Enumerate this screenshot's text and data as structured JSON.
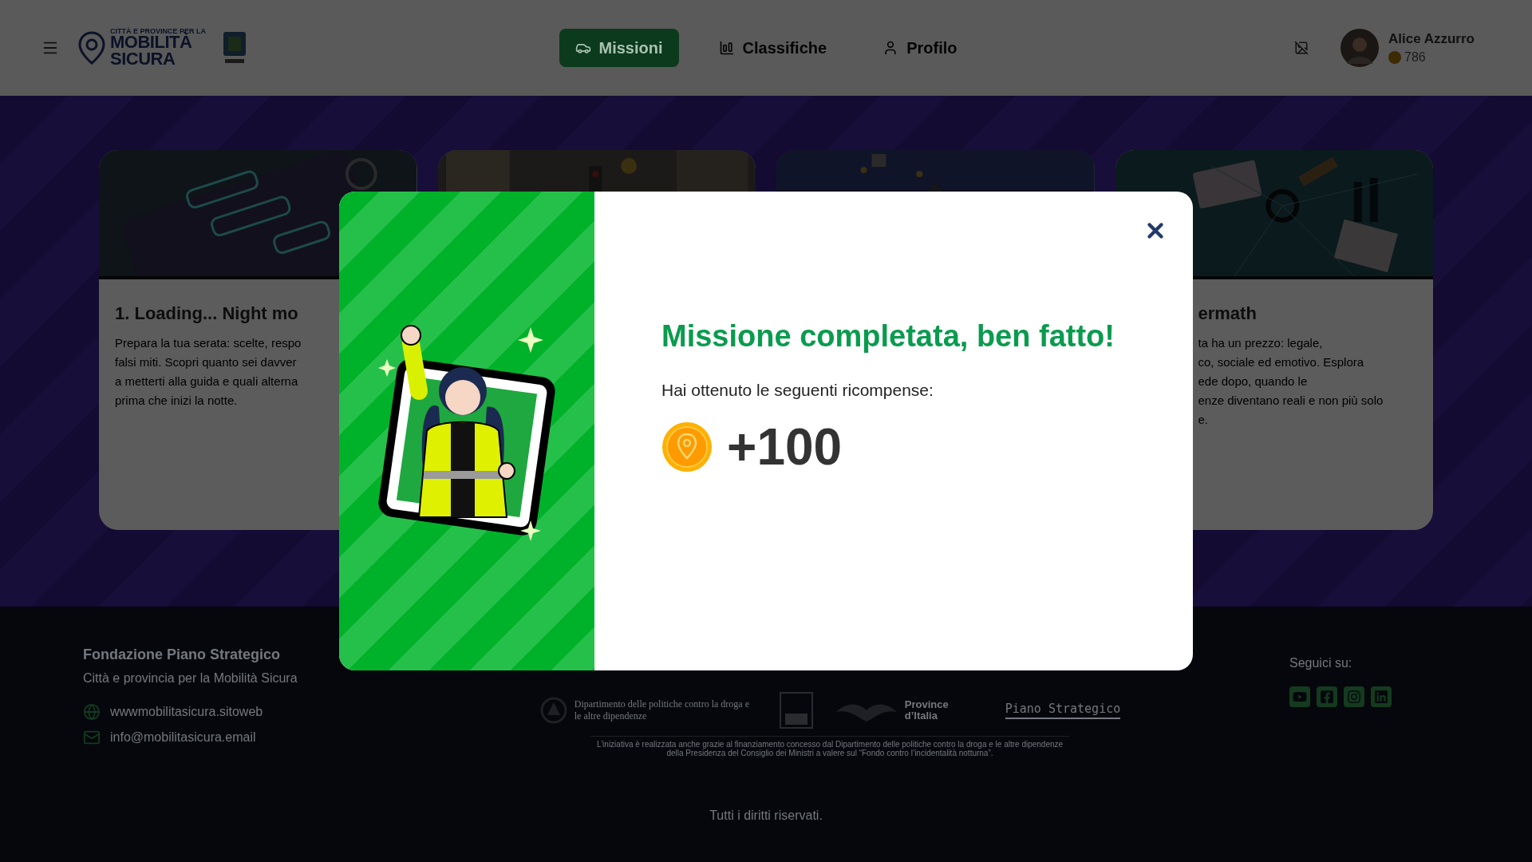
{
  "header": {
    "logo": {
      "line_1": "CITTÀ E PROVINCE PER LA",
      "line_2": "MOBILITÀ",
      "line_3": "SICURA"
    },
    "nav": [
      {
        "label": "Missioni",
        "kind": "missions",
        "selected": true
      },
      {
        "label": "Classifiche",
        "kind": "rankings",
        "selected": false
      },
      {
        "label": "Profilo",
        "kind": "profile",
        "selected": false
      }
    ],
    "user": {
      "name": "Alice Azzurro",
      "coins": "786"
    }
  },
  "missions": [
    {
      "picture": {
        "kind": "picture"
      },
      "title": "1. Loading... Night mo",
      "body_lines": [
        "Prepara la tua serata: scelte, respo",
        "falsi miti. Scopri quanto sei davver",
        "a metterti alla guida e quali alterna",
        "prima che inizi la notte."
      ]
    },
    {
      "picture": {
        "kind": "picture"
      }
    },
    {
      "picture": {
        "kind": "picture"
      }
    },
    {
      "picture": {
        "kind": "picture"
      },
      "title": "ermath",
      "body_lines": [
        "ta ha un prezzo: legale,",
        "co, sociale ed emotivo. Esplora",
        "ede dopo, quando le",
        "enze diventano reali e non più solo",
        "e."
      ]
    }
  ],
  "footer": {
    "org": "Fondazione Piano Strategico",
    "tagline": "Città e provincia per la Mobilità Sicura",
    "contacts": [
      {
        "kind": "web",
        "text": "wwwmobilitasicura.sitoweb"
      },
      {
        "kind": "mail",
        "text": "info@mobilitasicura.email"
      }
    ],
    "partners": {
      "dept": "Dipartimento delle politiche contro la droga e le altre dipendenze",
      "upi": "Province d’Italia",
      "foundation": "Piano Strategico",
      "note": "L’iniziativa è realizzata anche grazie al finanziamento concesso dal Dipartimento delle politiche contro la droga e le altre dipendenze della Presidenza del Consiglio dei Ministri a valere sul “Fondo contro l’incidentalità notturna”."
    },
    "follow": "Seguici su:",
    "socials": [
      {
        "kind": "youtube"
      },
      {
        "kind": "facebook"
      },
      {
        "kind": "instagram"
      },
      {
        "kind": "linkedin"
      }
    ],
    "copyright": "Tutti i diritti riservati."
  },
  "modal": {
    "title": "Missione completata, ben fatto!",
    "subtitle": "Hai ottenuto le seguenti ricompense:",
    "reward": "+100"
  }
}
